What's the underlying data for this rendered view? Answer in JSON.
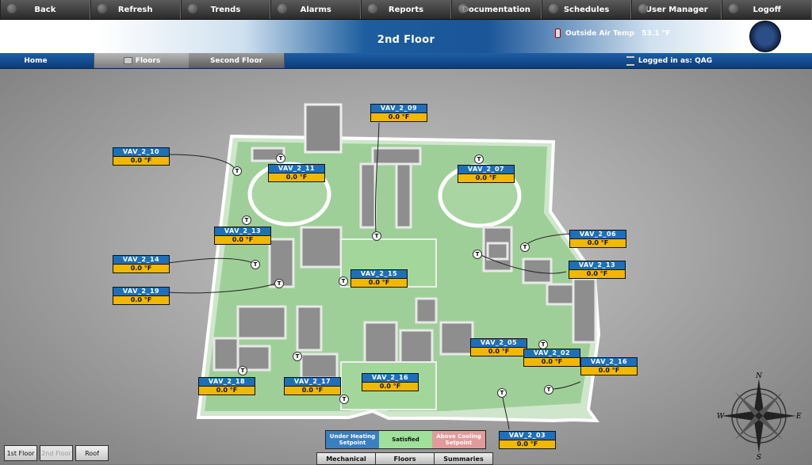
{
  "topnav": [
    "Back",
    "Refresh",
    "Trends",
    "Alarms",
    "Reports",
    "Documentation",
    "Schedules",
    "User Manager",
    "Logoff"
  ],
  "header": {
    "title": "2nd Floor",
    "oat_label": "Outside Air Temp",
    "oat_value": "53.1 °F"
  },
  "subnav": {
    "home": "Home",
    "floors": "Floors",
    "second": "Second Floor",
    "logged": "Logged in as: QAG"
  },
  "vavs": [
    {
      "name": "VAV_2_09",
      "temp": "0.0 °F"
    },
    {
      "name": "VAV_2_10",
      "temp": "0.0 °F"
    },
    {
      "name": "VAV_2_11",
      "temp": "0.0 °F"
    },
    {
      "name": "VAV_2_07",
      "temp": "0.0 °F"
    },
    {
      "name": "VAV_2_13",
      "temp": "0.0 °F"
    },
    {
      "name": "VAV_2_06",
      "temp": "0.0 °F"
    },
    {
      "name": "VAV_2_14",
      "temp": "0.0 °F"
    },
    {
      "name": "VAV_2_15",
      "temp": "0.0 °F"
    },
    {
      "name": "VAV_2_13",
      "temp": "0.0 °F"
    },
    {
      "name": "VAV_2_19",
      "temp": "0.0 °F"
    },
    {
      "name": "VAV_2_05",
      "temp": "0.0 °F"
    },
    {
      "name": "VAV_2_02",
      "temp": "0.0 °F"
    },
    {
      "name": "VAV_2_16",
      "temp": "0.0 °F"
    },
    {
      "name": "VAV_2_18",
      "temp": "0.0 °F"
    },
    {
      "name": "VAV_2_17",
      "temp": "0.0 °F"
    },
    {
      "name": "VAV_2_16",
      "temp": "0.0 °F"
    },
    {
      "name": "VAV_2_03",
      "temp": "0.0 °F"
    }
  ],
  "tstat_glyph": "T",
  "floors": [
    "1st Floor",
    "2nd Floor",
    "Roof"
  ],
  "legend": {
    "heating": "Under Heating Setpoint",
    "satisfied": "Satisfied",
    "cooling": "Above Cooling Setpoint"
  },
  "tabs": [
    "Mechanical",
    "Floors",
    "Summaries"
  ],
  "compass": {
    "n": "N",
    "s": "S",
    "e": "E",
    "w": "W"
  },
  "colors": {
    "vav_name": "#1f6fb8",
    "vav_temp": "#f1b800",
    "heating": "#3a7fc0",
    "satisfied": "#9fe09a",
    "cooling": "#e29a9a"
  }
}
